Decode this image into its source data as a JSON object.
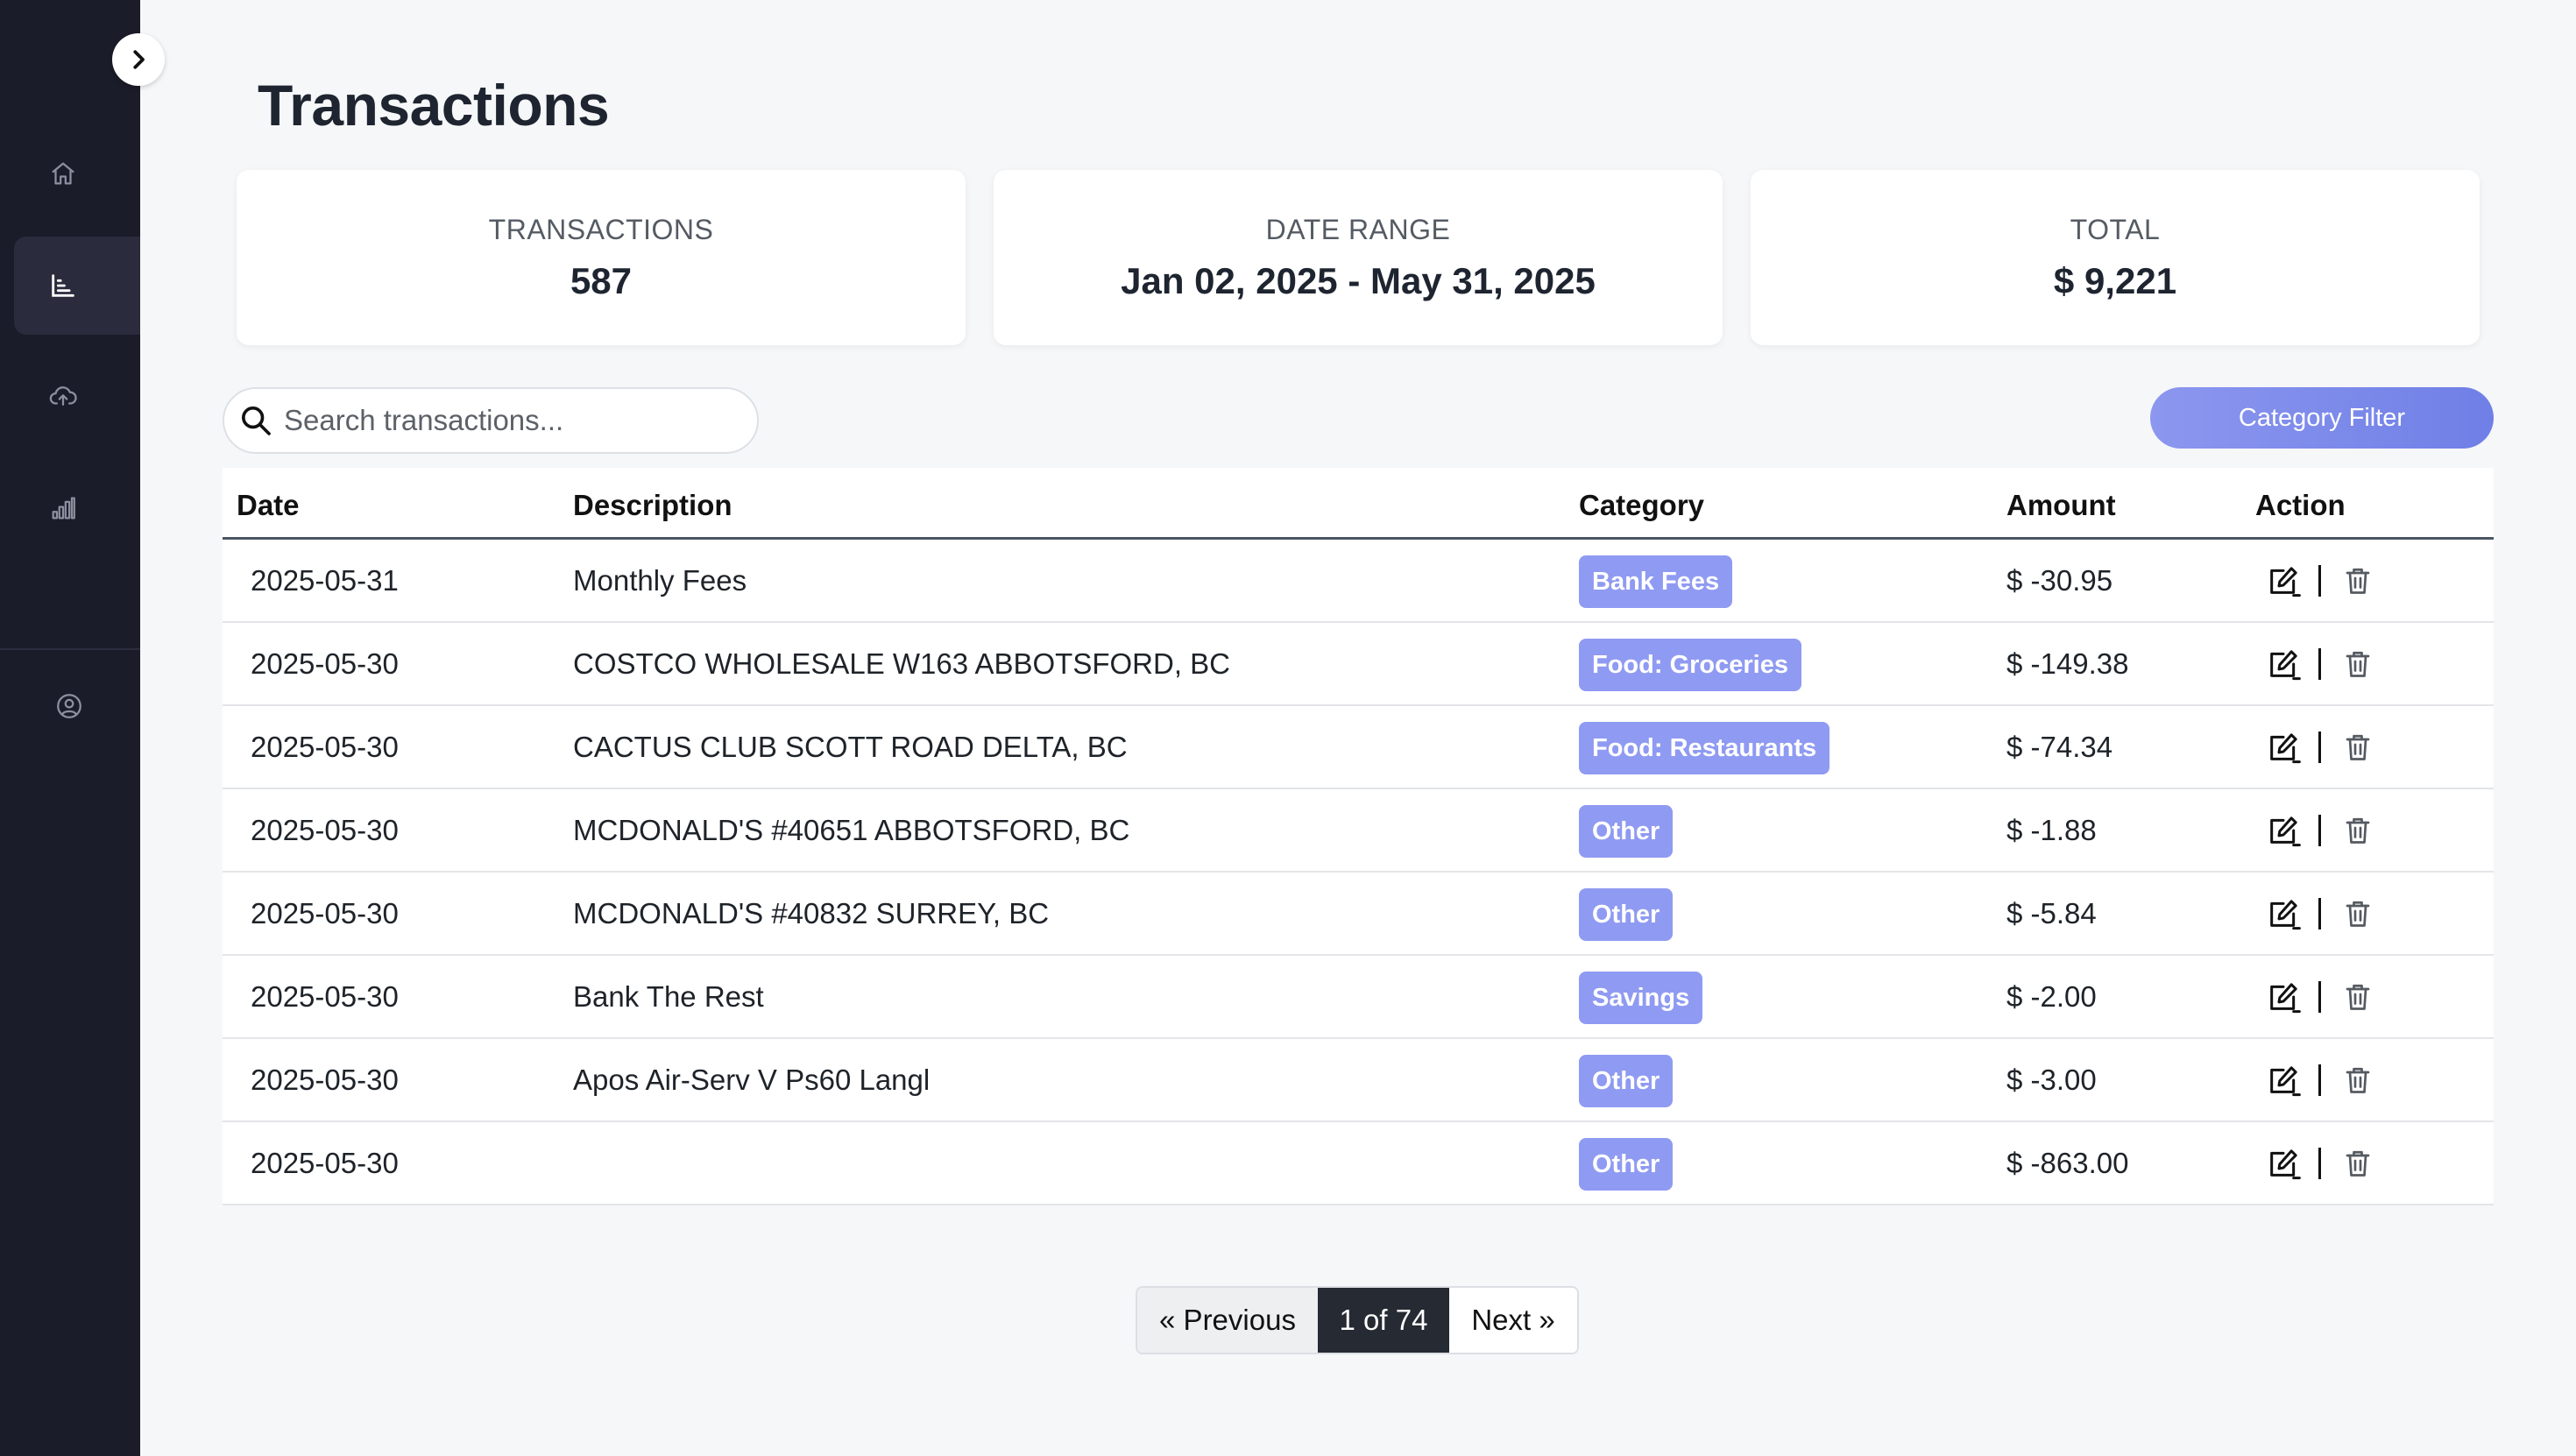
{
  "page": {
    "title": "Transactions"
  },
  "sidebar": {
    "toggle_icon": "chevron-right-icon",
    "items": [
      {
        "name": "home",
        "icon": "home-icon",
        "active": false
      },
      {
        "name": "transactions",
        "icon": "bar-chart-icon",
        "active": true
      },
      {
        "name": "upload",
        "icon": "cloud-upload-icon",
        "active": false
      },
      {
        "name": "reports",
        "icon": "signal-bars-icon",
        "active": false
      },
      {
        "name": "profile",
        "icon": "user-circle-icon",
        "active": false
      }
    ]
  },
  "stats": {
    "transactions": {
      "label": "TRANSACTIONS",
      "value": "587"
    },
    "date_range": {
      "label": "DATE RANGE",
      "value": "Jan 02, 2025 - May 31, 2025"
    },
    "total": {
      "label": "TOTAL",
      "value": "$ 9,221"
    }
  },
  "search": {
    "placeholder": "Search transactions...",
    "value": ""
  },
  "filter": {
    "label": "Category Filter"
  },
  "table": {
    "columns": [
      "Date",
      "Description",
      "Category",
      "Amount",
      "Action"
    ],
    "rows": [
      {
        "date": "2025-05-31",
        "description": "Monthly Fees",
        "category": "Bank Fees",
        "amount": "$ -30.95"
      },
      {
        "date": "2025-05-30",
        "description": "COSTCO WHOLESALE W163 ABBOTSFORD, BC",
        "category": "Food: Groceries",
        "amount": "$ -149.38"
      },
      {
        "date": "2025-05-30",
        "description": "CACTUS CLUB SCOTT ROAD DELTA, BC",
        "category": "Food: Restaurants",
        "amount": "$ -74.34"
      },
      {
        "date": "2025-05-30",
        "description": "MCDONALD'S #40651 ABBOTSFORD, BC",
        "category": "Other",
        "amount": "$ -1.88"
      },
      {
        "date": "2025-05-30",
        "description": "MCDONALD'S #40832 SURREY, BC",
        "category": "Other",
        "amount": "$ -5.84"
      },
      {
        "date": "2025-05-30",
        "description": "Bank The Rest",
        "category": "Savings",
        "amount": "$ -2.00"
      },
      {
        "date": "2025-05-30",
        "description": "Apos Air-Serv V Ps60 Langl",
        "category": "Other",
        "amount": "$ -3.00"
      },
      {
        "date": "2025-05-30",
        "description": "",
        "category": "Other",
        "amount": "$ -863.00"
      }
    ]
  },
  "pagination": {
    "prev_label": "« Previous",
    "current_label": "1 of 74",
    "next_label": "Next »"
  },
  "colors": {
    "sidebar_bg": "#1b1c29",
    "badge": "#8f9af2",
    "accent": "#7b88ea",
    "active_page": "#252a33"
  }
}
